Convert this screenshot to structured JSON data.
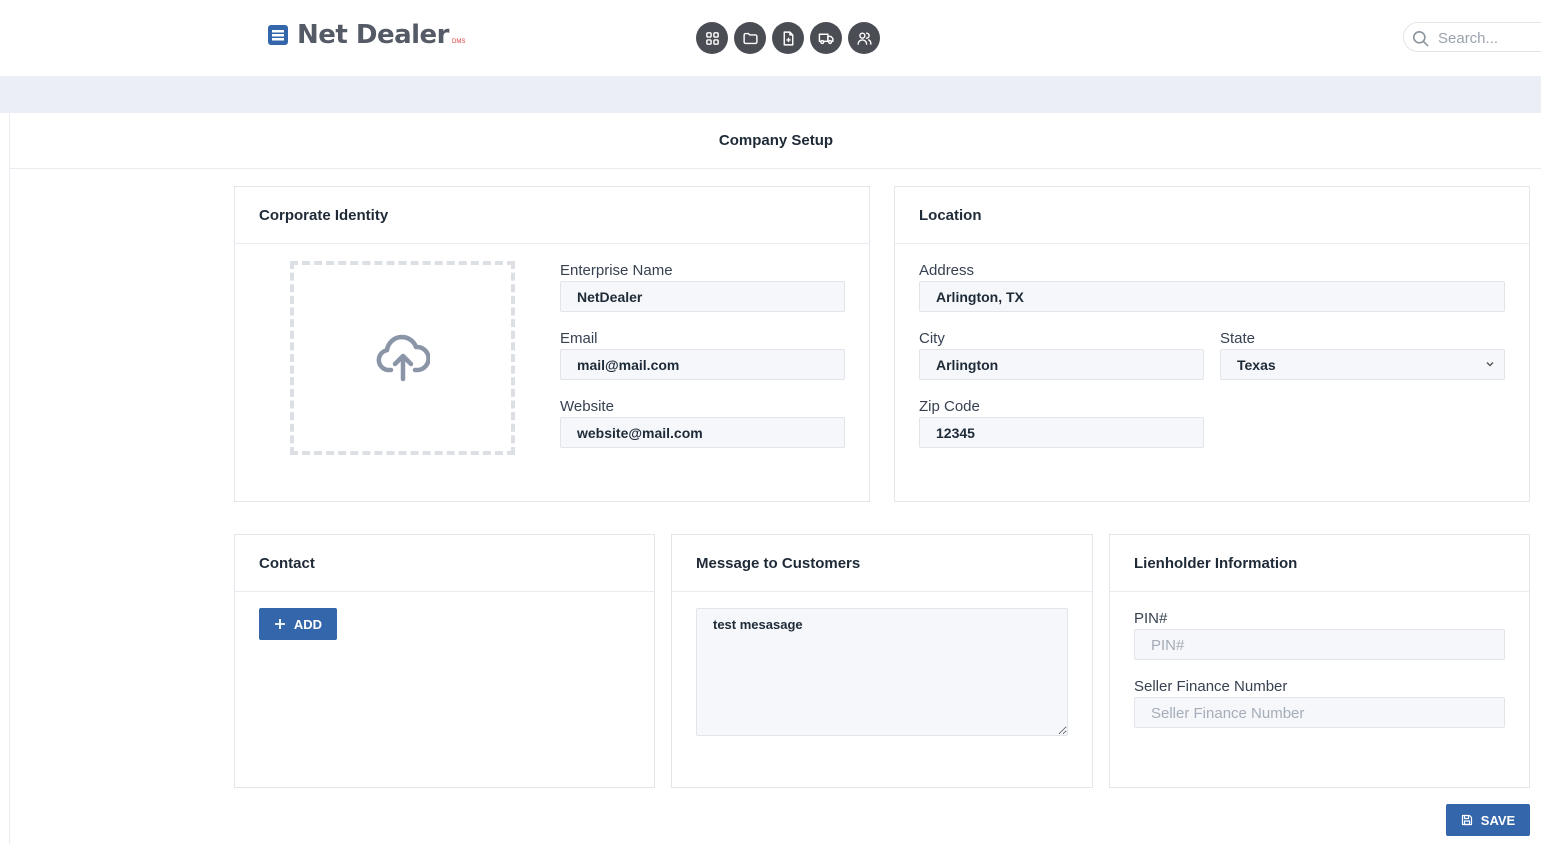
{
  "app": {
    "name": "Net Dealer",
    "sub": "DMS"
  },
  "search": {
    "placeholder": "Search..."
  },
  "nav": {
    "icons": [
      "dashboard-icon",
      "folder-icon",
      "file-add-icon",
      "truck-icon",
      "users-icon"
    ]
  },
  "page": {
    "title": "Company Setup"
  },
  "corporate": {
    "title": "Corporate Identity",
    "enterprise_label": "Enterprise Name",
    "enterprise_value": "NetDealer",
    "email_label": "Email",
    "email_value": "mail@mail.com",
    "website_label": "Website",
    "website_value": "website@mail.com"
  },
  "location": {
    "title": "Location",
    "address_label": "Address",
    "address_value": "Arlington, TX",
    "city_label": "City",
    "city_value": "Arlington",
    "state_label": "State",
    "state_value": "Texas",
    "zip_label": "Zip Code",
    "zip_value": "12345"
  },
  "contact": {
    "title": "Contact",
    "add_label": "ADD"
  },
  "message": {
    "title": "Message to Customers",
    "value": "test mesasage"
  },
  "lienholder": {
    "title": "Lienholder Information",
    "pin_label": "PIN#",
    "pin_placeholder": "PIN#",
    "seller_label": "Seller Finance Number",
    "seller_placeholder": "Seller Finance Number"
  },
  "actions": {
    "save_label": "SAVE"
  },
  "colors": {
    "primary": "#3366aa",
    "nav_icon_bg": "#4a4d53",
    "band": "#ebeef5",
    "field_bg": "#f5f7fa"
  }
}
